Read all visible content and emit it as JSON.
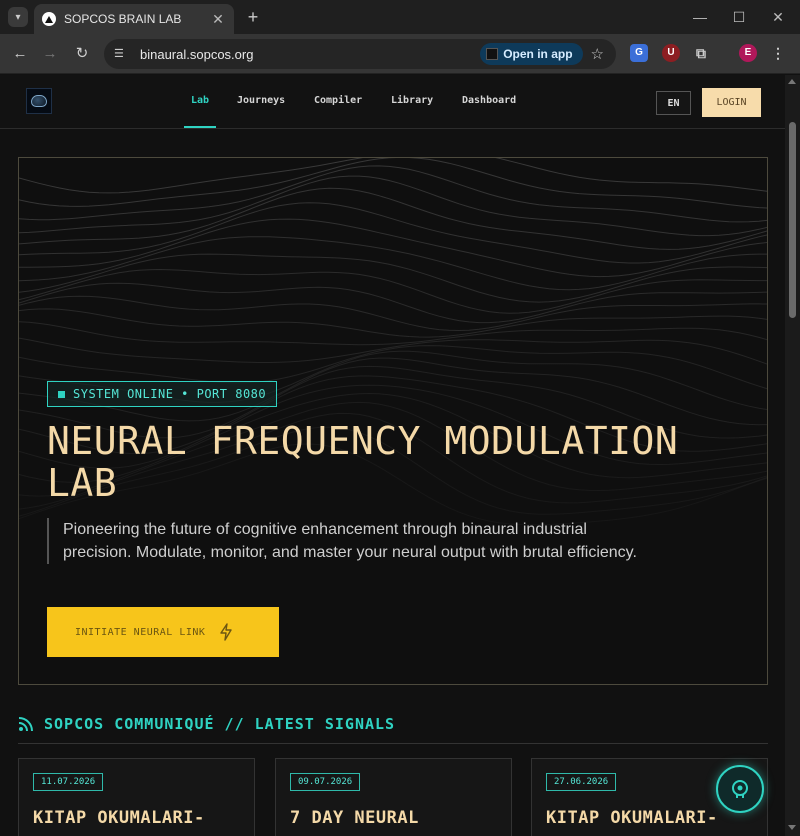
{
  "browser": {
    "tab_title": "SOPCOS BRAIN LAB",
    "url": "binaural.sopcos.org",
    "open_in_app_label": "Open in app",
    "profile_initial": "E"
  },
  "nav": {
    "links": [
      "Lab",
      "Journeys",
      "Compiler",
      "Library",
      "Dashboard"
    ],
    "active": "Lab",
    "lang": "EN",
    "login": "LOGIN"
  },
  "hero": {
    "status": "SYSTEM ONLINE • PORT 8080",
    "title": "NEURAL FREQUENCY MODULATION LAB",
    "description": "Pioneering the future of cognitive enhancement through binaural industrial precision. Modulate, monitor, and master your neural output with brutal efficiency.",
    "cta": "INITIATE NEURAL LINK"
  },
  "communique": {
    "title": "SOPCOS COMMUNIQUÉ // LATEST SIGNALS",
    "cards": [
      {
        "date": "11.07.2026",
        "title": "KITAP OKUMALARI-"
      },
      {
        "date": "09.07.2026",
        "title": "7 DAY NEURAL"
      },
      {
        "date": "27.06.2026",
        "title": "KITAP OKUMALARI-"
      }
    ]
  },
  "colors": {
    "accent_teal": "#2fd3c2",
    "title_cream": "#f4d9a8",
    "cta_yellow": "#f7c51b",
    "login_bg": "#f7dcab"
  }
}
